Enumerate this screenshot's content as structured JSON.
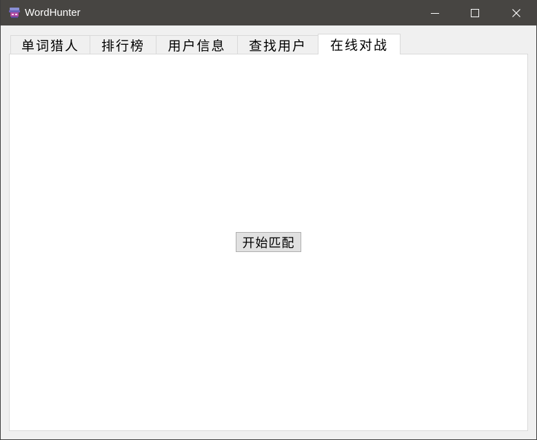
{
  "window": {
    "title": "WordHunter",
    "app_icon": "wordhunter-app-icon",
    "controls": {
      "minimize_icon": "minimize-icon",
      "maximize_icon": "maximize-icon",
      "close_icon": "close-icon"
    }
  },
  "tabs": [
    {
      "label": "单词猎人",
      "active": false
    },
    {
      "label": "排行榜",
      "active": false
    },
    {
      "label": "用户信息",
      "active": false
    },
    {
      "label": "查找用户",
      "active": false
    },
    {
      "label": "在线对战",
      "active": true
    }
  ],
  "online_battle": {
    "start_match_label": "开始匹配"
  },
  "colors": {
    "titlebar": "#474542",
    "window_bg": "#f0f0f0",
    "panel_bg": "#ffffff",
    "button_bg": "#e1e1e1"
  }
}
